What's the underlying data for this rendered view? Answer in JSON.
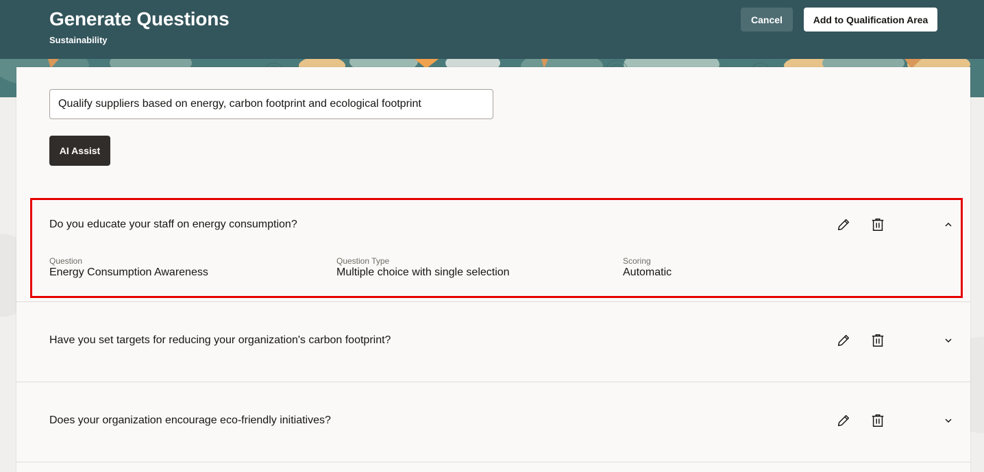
{
  "header": {
    "title": "Generate Questions",
    "subtitle": "Sustainability",
    "cancel_label": "Cancel",
    "add_label": "Add to Qualification Area"
  },
  "prompt": {
    "value": "Qualify suppliers based on energy, carbon footprint and ecological footprint"
  },
  "ai_assist_label": "AI Assist",
  "questions": [
    {
      "text": "Do you educate your staff on energy consumption?",
      "expanded": true,
      "details": {
        "question_label": "Question",
        "question_value": "Energy Consumption Awareness",
        "type_label": "Question Type",
        "type_value": "Multiple choice with single selection",
        "scoring_label": "Scoring",
        "scoring_value": "Automatic"
      }
    },
    {
      "text": "Have you set targets for reducing your organization's carbon footprint?",
      "expanded": false
    },
    {
      "text": "Does your organization encourage eco-friendly initiatives?",
      "expanded": false
    }
  ],
  "icons": {
    "edit": "pencil-icon",
    "delete": "trash-icon",
    "expand": "chevron-icon"
  },
  "colors": {
    "header_bg": "#33555c",
    "highlight": "#e60000",
    "ai_button": "#312d2a"
  }
}
